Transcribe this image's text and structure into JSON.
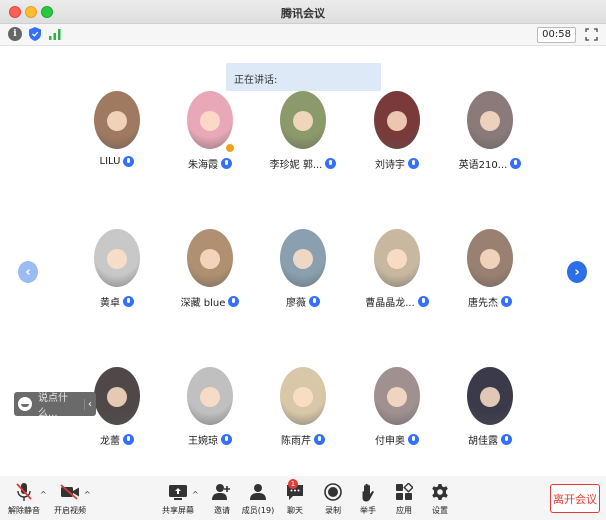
{
  "window": {
    "title": "腾讯会议"
  },
  "toolbar": {
    "timer": "00:58"
  },
  "speaking": {
    "label": "正在讲话:"
  },
  "participants": [
    {
      "name": "LILU",
      "color": "#a07a60"
    },
    {
      "name": "朱海霞",
      "color": "#e9a8b8"
    },
    {
      "name": "李珍妮 郭...",
      "color": "#8b9a6a"
    },
    {
      "name": "刘诗宇",
      "color": "#7a3a3a"
    },
    {
      "name": "英语210...",
      "color": "#8a7a7a"
    },
    {
      "name": "黄卓",
      "color": "#c8c8c8"
    },
    {
      "name": "深藏 blue",
      "color": "#b09070"
    },
    {
      "name": "廖薇",
      "color": "#8aa0b0"
    },
    {
      "name": "曹晶晶龙...",
      "color": "#c8b8a0"
    },
    {
      "name": "唐先杰",
      "color": "#9a8070"
    },
    {
      "name": "龙蕾",
      "color": "#504848"
    },
    {
      "name": "王婉琼",
      "color": "#c0c0c0"
    },
    {
      "name": "陈雨芹",
      "color": "#d8c8a8"
    },
    {
      "name": "付申奥",
      "color": "#a09090"
    },
    {
      "name": "胡佳露",
      "color": "#3a3a4a"
    }
  ],
  "chat": {
    "placeholder": "说点什么..."
  },
  "bottombar": {
    "unmute": "解除静音",
    "start_video": "开启视频",
    "share_screen": "共享屏幕",
    "invite": "邀请",
    "members": "成员(19)",
    "chat": "聊天",
    "chat_badge": "1",
    "record": "录制",
    "raise_hand": "举手",
    "apps": "应用",
    "settings": "设置",
    "leave": "离开会议"
  },
  "colors": {
    "accent": "#3370ff",
    "danger": "#e53935"
  }
}
